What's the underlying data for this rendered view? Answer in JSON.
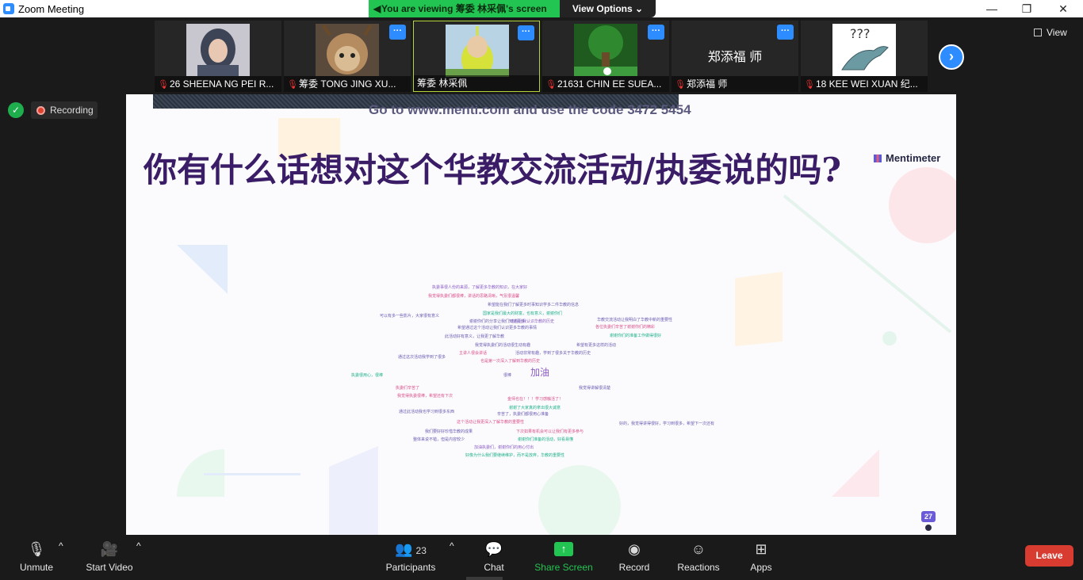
{
  "window": {
    "title": "Zoom Meeting",
    "viewing_banner": "You are viewing 筹委 林采佩's screen",
    "view_options": "View Options",
    "controls": {
      "minimize": "—",
      "maximize": "❐",
      "close": "✕"
    }
  },
  "participants_strip": [
    {
      "name": "26 SHEENA NG PEI R...",
      "muted": true,
      "type": "photo",
      "menu": false
    },
    {
      "name": "筹委 TONG JING XU...",
      "muted": true,
      "type": "photo",
      "menu": true
    },
    {
      "name": "筹委 林采佩",
      "muted": false,
      "type": "photo",
      "menu": true,
      "active": true
    },
    {
      "name": "21631 CHIN EE SUEA...",
      "muted": true,
      "type": "photo",
      "menu": true
    },
    {
      "name": "郑添福 师",
      "muted": true,
      "type": "namecard",
      "card_text": "郑添福 师",
      "menu": true
    },
    {
      "name": "18 KEE WEI XUAN 纪...",
      "muted": true,
      "type": "photo",
      "menu": false
    }
  ],
  "strip_view_label": "View",
  "status": {
    "recording_label": "Recording"
  },
  "shared_screen": {
    "instruction": "Go to www.menti.com and use the code 3472 5454",
    "question": "你有什么话想对这个华教交流活动/执委说的吗?",
    "brand": "Mentimeter",
    "response_count": "27",
    "word_cloud": [
      {
        "t": "执委事很人份的来源，了解更多华教的知识，在大家好",
        "c": "#8a5cc4"
      },
      {
        "t": "我觉得执委们都很棒，讲话的思路清晰，气氛很温馨",
        "c": "#d94f8a"
      },
      {
        "t": "希望能在我们了解更多时事知识学多二件华教的信息",
        "c": "#6a5ab0"
      },
      {
        "t": "国家是我们最大的财富，也有意义，谢谢你们",
        "c": "#1fb08a"
      },
      {
        "t": "可以有多一些影片，大家很有意义",
        "c": "#6a5ab0"
      },
      {
        "t": "也在让我认识华教的历史",
        "c": "#8a5cc4"
      },
      {
        "t": "谢谢你们的分享让我们知道更多",
        "c": "#6a5ab0"
      },
      {
        "t": "希望通过这个活动让我们认识更多华教的事情",
        "c": "#6a5ab0"
      },
      {
        "t": "华教交流活动让我明白了华教中新的重要性",
        "c": "#6a5ab0"
      },
      {
        "t": "各位执委们辛苦了谢谢你们的精彩",
        "c": "#d94f8a"
      },
      {
        "t": "此活动好有意义，让我更了解华教",
        "c": "#6a5ab0"
      },
      {
        "t": "谢谢你们的准备工作做得很好",
        "c": "#1fb08a"
      },
      {
        "t": "我觉得执委们的活动很生动有趣",
        "c": "#6a5ab0"
      },
      {
        "t": "希望有更多这样的活动",
        "c": "#6a5ab0"
      },
      {
        "t": "主讲人很会讲话",
        "c": "#d94f8a"
      },
      {
        "t": "活动非常有趣，学到了很多关于华教的历史",
        "c": "#6a5ab0"
      },
      {
        "t": "也是第一次深入了解到华教的历史",
        "c": "#d94f8a"
      },
      {
        "t": "加油",
        "c": "#8a5cc4",
        "big": true
      },
      {
        "t": "执委很用心，很棒",
        "c": "#1fb08a"
      },
      {
        "t": "很棒",
        "c": "#6a5ab0"
      },
      {
        "t": "通过这次活动我学到了很多",
        "c": "#6a5ab0"
      },
      {
        "t": "执委们辛苦了",
        "c": "#d94f8a"
      },
      {
        "t": "我觉得执委很棒，希望还有下次",
        "c": "#d94f8a"
      },
      {
        "t": "我觉得讲解很清楚",
        "c": "#6a5ab0"
      },
      {
        "t": "金师也在！！！学习感触活了！",
        "c": "#d94f8a"
      },
      {
        "t": "通过此活动我也学习到很多东西",
        "c": "#6a5ab0"
      },
      {
        "t": "谢谢了大家真的拿出很大诚意",
        "c": "#1fb08a"
      },
      {
        "t": "辛苦了，执委们都很用心准备",
        "c": "#6a5ab0"
      },
      {
        "t": "好的，我觉得讲得很好，学习到很多，希望下一次还有",
        "c": "#6a5ab0"
      },
      {
        "t": "这个活动让我更深入了解华教的重要性",
        "c": "#d94f8a"
      },
      {
        "t": "我们要好好珍惜华教的成果",
        "c": "#6a5ab0"
      },
      {
        "t": "下次如果有机会可以让我们有更多参与",
        "c": "#d94f8a"
      },
      {
        "t": "整体来说不错，但是内容较少",
        "c": "#6a5ab0"
      },
      {
        "t": "谢谢你们准备的活动，好看易懂",
        "c": "#1fb08a"
      },
      {
        "t": "加油执委们，谢谢你们的用心付出",
        "c": "#8a5cc4"
      },
      {
        "t": "好像为什么我们要继续维护，而不是放弃，华教的重要性",
        "c": "#1fb08a"
      }
    ]
  },
  "toolbar": {
    "unmute": "Unmute",
    "start_video": "Start Video",
    "participants": "Participants",
    "participants_count": "23",
    "chat": "Chat",
    "share_screen": "Share Screen",
    "record": "Record",
    "reactions": "Reactions",
    "apps": "Apps",
    "leave": "Leave"
  }
}
